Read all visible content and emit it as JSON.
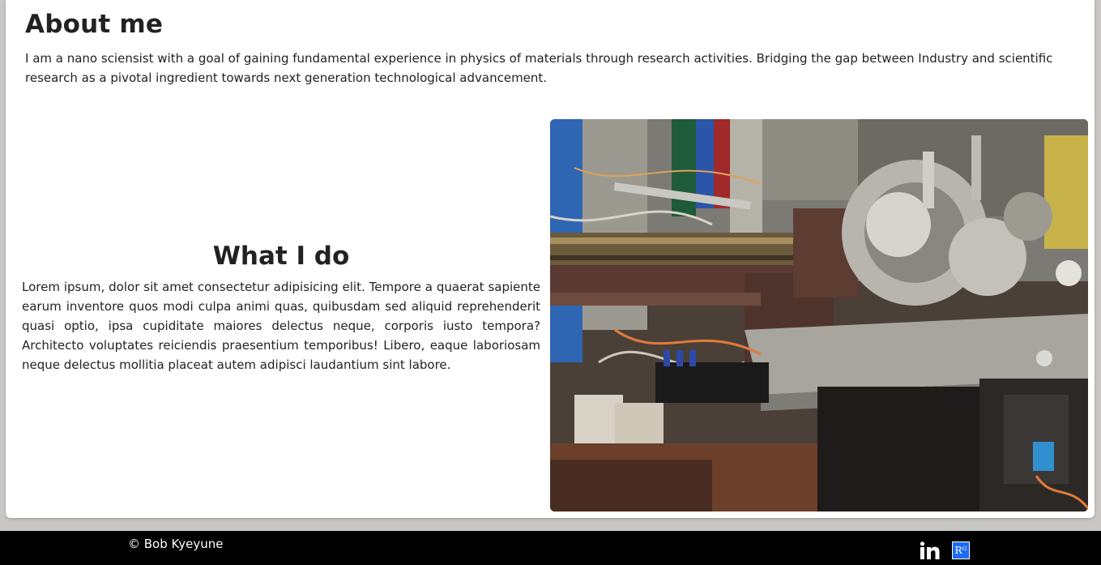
{
  "about": {
    "title": "About me",
    "text": "I am a nano sciensist with a goal of gaining fundamental experience in physics of materials through research activities. Bridging the gap between Industry and scientific research as a pivotal ingredient towards next generation technological advancement."
  },
  "what_i_do": {
    "title": "What I do",
    "text": "Lorem ipsum, dolor sit amet consectetur adipisicing elit. Tempore a quaerat sapiente earum inventore quos modi culpa animi quas, quibusdam sed aliquid reprehenderit quasi optio, ipsa cupiditate maiores delectus neque, corporis iusto tempora? Architecto voluptates reiciendis praesentium temporibus! Libero, eaque laboriosam neque delectus mollitia placeat autem adipisci laudantium sint labore."
  },
  "photo": {
    "subject": "laboratory vacuum chamber equipment"
  },
  "footer": {
    "copyright": "© Bob Kyeyune",
    "social": [
      {
        "icon": "linkedin-icon",
        "glyph": "in"
      },
      {
        "icon": "researchgate-icon",
        "glyph": "Rᴳ"
      }
    ]
  },
  "colors": {
    "background": "#c9c6c6",
    "card": "#ffffff",
    "footer": "#000000",
    "researchgate": "#1d6cf0"
  }
}
